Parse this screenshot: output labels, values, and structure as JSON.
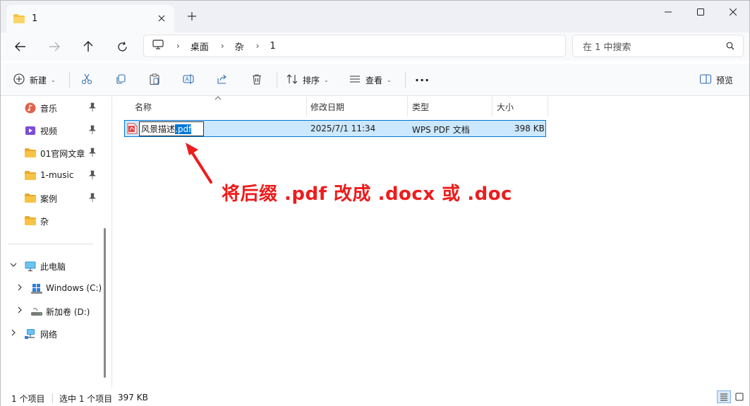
{
  "tab": {
    "title": "1"
  },
  "address": {
    "crumbs": [
      "桌面",
      "杂",
      "1"
    ]
  },
  "search": {
    "placeholder": "在 1 中搜索"
  },
  "toolbar": {
    "new_label": "新建",
    "sort_label": "排序",
    "view_label": "查看",
    "more_label": "···",
    "preview_label": "预览"
  },
  "sidebar": {
    "quick": [
      {
        "label": "音乐",
        "icon": "music-icon"
      },
      {
        "label": "视频",
        "icon": "video-icon"
      },
      {
        "label": "01官网文章",
        "icon": "folder-icon"
      },
      {
        "label": "1-music",
        "icon": "folder-icon"
      },
      {
        "label": "案例",
        "icon": "folder-icon"
      },
      {
        "label": "杂",
        "icon": "folder-icon"
      }
    ],
    "this_pc": "此电脑",
    "drive_c": "Windows (C:)",
    "drive_d": "新加卷 (D:)",
    "network": "网络"
  },
  "columns": {
    "name": "名称",
    "modified": "修改日期",
    "type": "类型",
    "size": "大小"
  },
  "file": {
    "name_base": "风景描述",
    "name_ext": ".pdf",
    "modified": "2025/7/1 11:34",
    "type": "WPS PDF 文档",
    "size": "398 KB"
  },
  "annotation": "将后缀 .pdf 改成 .docx 或 .doc",
  "status": {
    "count": "1 个项目",
    "selected": "选中 1 个项目",
    "selected_size": "397 KB"
  },
  "colors": {
    "accent": "#0078d7",
    "selection_bg": "#cce8ff",
    "annotation_red": "#ee1c1c",
    "folder_yellow": "#f6c344"
  }
}
